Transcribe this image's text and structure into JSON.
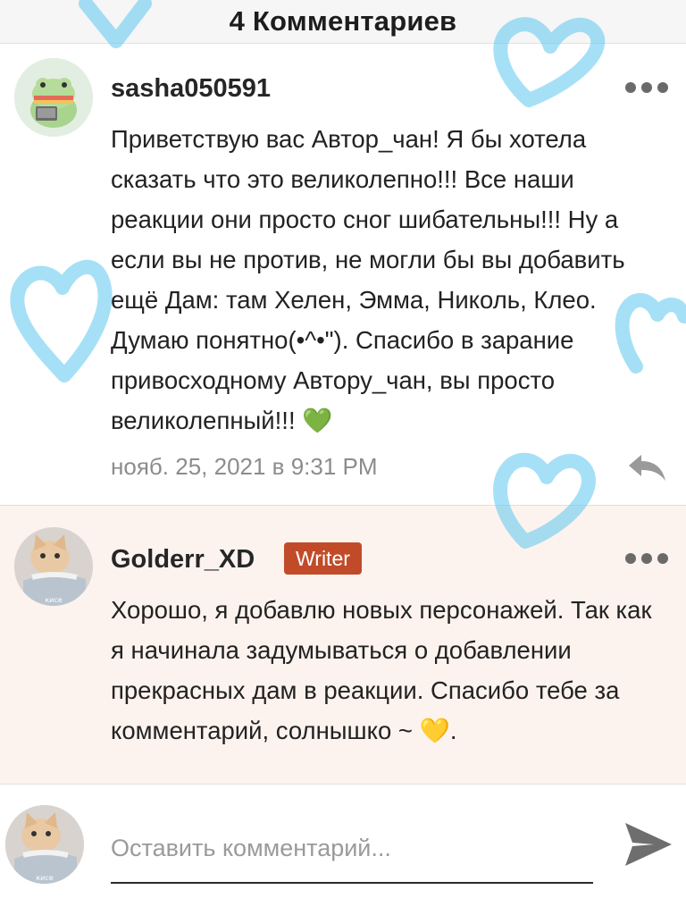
{
  "header": {
    "title": "4 Комментариев"
  },
  "comments": [
    {
      "username": "sasha050591",
      "text": "Приветствую вас Автор_чан! Я бы хотела сказать что это великолепно!!! Все наши реакции они просто сног шибательны!!! Ну а если вы не против, не могли бы вы добавить ещё Дам: там Хелен, Эмма, Николь, Клео. Думаю понятно(•^•\"). Спасибо в зарание привосходному Автору_чан, вы просто великолепный!!! 💚",
      "timestamp": "нояб. 25, 2021 в 9:31 PM",
      "avatar_icon": "frog-with-laptop-avatar"
    },
    {
      "username": "Golderr_XD",
      "badge": "Writer",
      "text": "Хорошо, я добавлю новых персонажей. Так как я начинала задумываться о добавлении прекрасных дам в реакции. Спасибо тебе за комментарий, солнышко ~ 💛.",
      "avatar_icon": "cat-avatar",
      "avatar_caption": "кисе"
    }
  ],
  "composer": {
    "placeholder": "Оставить комментарий...",
    "avatar_caption": "кисе"
  },
  "colors": {
    "badge": "#c14b28",
    "reply_background": "#fdf3ee",
    "heart_overlay": "#5cc6f0"
  }
}
